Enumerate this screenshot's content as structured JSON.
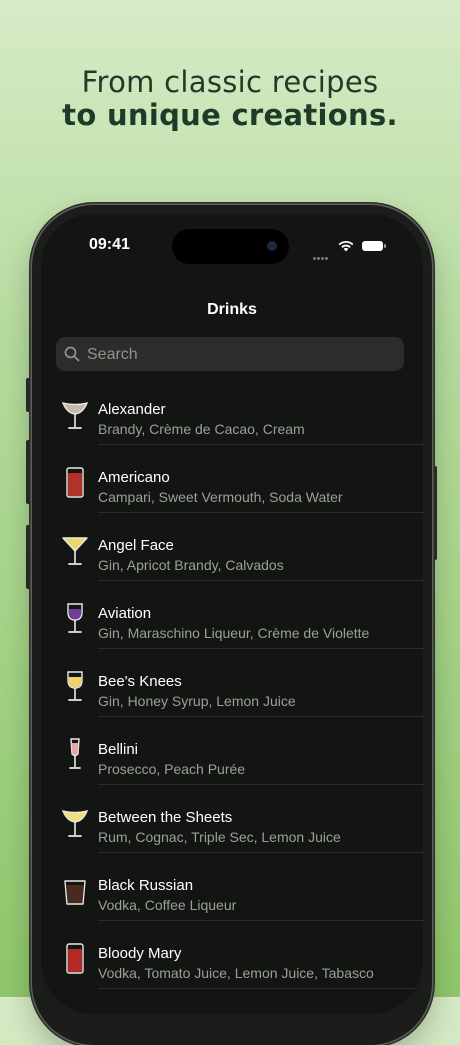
{
  "headline": {
    "line1": "From classic recipes",
    "line2": "to unique creations."
  },
  "status_bar": {
    "time": "09:41"
  },
  "nav": {
    "title": "Drinks"
  },
  "search": {
    "placeholder": "Search"
  },
  "drinks": [
    {
      "name": "Alexander",
      "ingredients": "Brandy, Crème de Cacao, Cream",
      "glass": "coupe-icon",
      "color": "#c9b9a6"
    },
    {
      "name": "Americano",
      "ingredients": "Campari, Sweet Vermouth, Soda Water",
      "glass": "highball-icon",
      "color": "#b2322b"
    },
    {
      "name": "Angel Face",
      "ingredients": "Gin, Apricot Brandy, Calvados",
      "glass": "martini-icon",
      "color": "#e8d86a"
    },
    {
      "name": "Aviation",
      "ingredients": "Gin, Maraschino Liqueur, Crème de Violette",
      "glass": "wine-icon",
      "color": "#6d3d9a"
    },
    {
      "name": "Bee's Knees",
      "ingredients": "Gin, Honey Syrup, Lemon Juice",
      "glass": "wine-icon",
      "color": "#f0d36d"
    },
    {
      "name": "Bellini",
      "ingredients": "Prosecco, Peach Purée",
      "glass": "flute-icon",
      "color": "#e9a4a8"
    },
    {
      "name": "Between the Sheets",
      "ingredients": "Rum, Cognac, Triple Sec, Lemon Juice",
      "glass": "coupe-icon",
      "color": "#efe07a"
    },
    {
      "name": "Black Russian",
      "ingredients": "Vodka, Coffee Liqueur",
      "glass": "rocks-icon",
      "color": "#4a2a1f"
    },
    {
      "name": "Bloody Mary",
      "ingredients": "Vodka, Tomato Juice, Lemon Juice, Tabasco",
      "glass": "highball-icon",
      "color": "#b12a24"
    }
  ]
}
